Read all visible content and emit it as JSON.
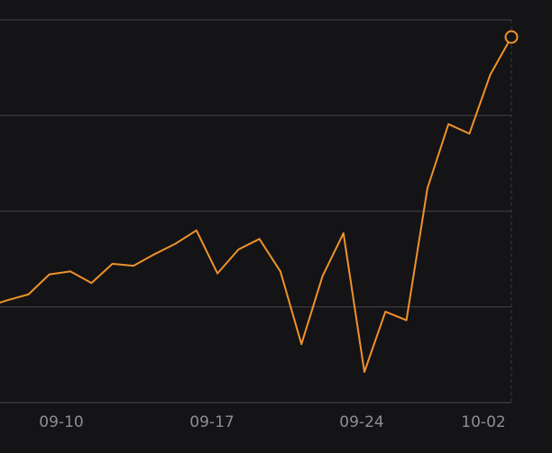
{
  "chart_data": {
    "type": "line",
    "title": "",
    "xlabel": "",
    "ylabel": "",
    "x_tick_labels": [
      "09-10",
      "09-17",
      "09-24",
      "10-02"
    ],
    "ylim": [
      0,
      4
    ],
    "grid": true,
    "series": [
      {
        "color": "#f0922a",
        "values": [
          1.0,
          1.07,
          1.13,
          1.34,
          1.37,
          1.25,
          1.45,
          1.43,
          1.55,
          1.66,
          1.8,
          1.35,
          1.6,
          1.71,
          1.37,
          0.61,
          1.32,
          1.77,
          0.32,
          0.95,
          0.86,
          2.24,
          2.91,
          2.81,
          3.43,
          3.82
        ]
      }
    ],
    "last_point_marker": true
  }
}
